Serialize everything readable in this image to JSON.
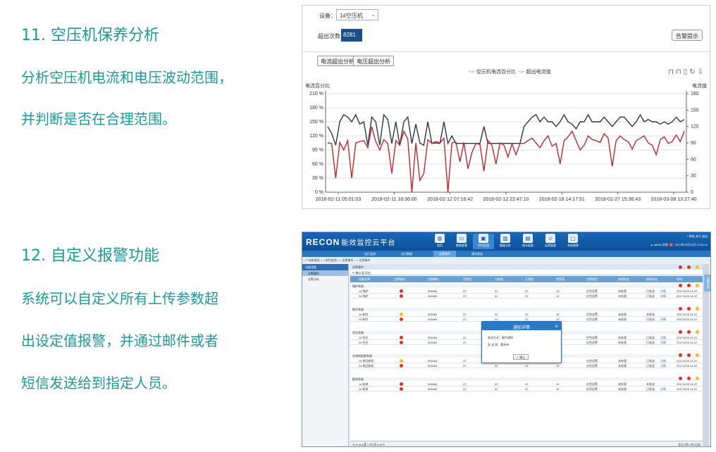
{
  "left_text": {
    "heading_11": "11. 空压机保养分析",
    "line_11_1": "分析空压机电流和电压波动范围，",
    "line_11_2": "并判断是否在合理范围。",
    "heading_12": "12. 自定义报警功能",
    "line_12_1": "系统可以自定义所有上传参数超",
    "line_12_2": "出设定值报警，并通过邮件或者",
    "line_12_3": "短信发送给到指定人员。"
  },
  "top_panel": {
    "device_label": "设备：",
    "device_value": "1#空压机",
    "exceed_label": "超出次数",
    "exceed_value": "8281",
    "alarm_button": "告警提示",
    "tab_current_exceed": "电流超出分析",
    "tab_voltage_exceed": "电压超出分析",
    "legend_percent": "空压机电流百分比",
    "legend_exceed": "超出电流值",
    "left_axis_label": "电流百分比",
    "right_axis_label": "电流值"
  },
  "chart_data": {
    "type": "line",
    "x_tick_labels": [
      "2018-02-11 05:01:03",
      "2018-02-11 18:36:00",
      "2018-02-12 07:16:42",
      "2018-02-12 22:47:10",
      "2018-02-18 14:17:51",
      "2018-02-27 15:36:43",
      "2018-03-08 13:27:40"
    ],
    "y_left_ticks": [
      "210 %",
      "180 %",
      "150 %",
      "120 %",
      "90 %",
      "60 %",
      "30 %",
      "0 %"
    ],
    "y_right_ticks": [
      "180",
      "150",
      "120",
      "90",
      "60",
      "30",
      "0"
    ],
    "ylim_left": [
      0,
      210
    ],
    "ylim_right": [
      0,
      180
    ],
    "grid": true,
    "legend": "top-center",
    "series": [
      {
        "name": "空压机电流百分比",
        "color": "#c0282e",
        "values": [
          105,
          104,
          30,
          106,
          90,
          110,
          30,
          105,
          108,
          110,
          95,
          140,
          108,
          90,
          112,
          104,
          40,
          110,
          100,
          130,
          113,
          0,
          105,
          25,
          40,
          112,
          104,
          108,
          105,
          115,
          0,
          105,
          107,
          65,
          106,
          50,
          85,
          104,
          102,
          45,
          110,
          100,
          60,
          105,
          100,
          75,
          103,
          80,
          104,
          104,
          110,
          115,
          105,
          95,
          110,
          120,
          98,
          104,
          60,
          110,
          118,
          130,
          110,
          90,
          100,
          120,
          112,
          110,
          106,
          125,
          115,
          55,
          110,
          120,
          112,
          108,
          92,
          110,
          115,
          120,
          105,
          100,
          80,
          112,
          118,
          104,
          108,
          122,
          108,
          130
        ]
      },
      {
        "name": "超出电流值",
        "color": "#2a3a4a",
        "values": [
          140,
          125,
          100,
          150,
          165,
          160,
          150,
          165,
          145,
          150,
          100,
          160,
          150,
          100,
          165,
          155,
          104,
          150,
          100,
          150,
          160,
          104,
          145,
          105,
          100,
          150,
          104,
          105,
          104,
          150,
          104,
          120,
          104,
          104,
          104,
          104,
          104,
          104,
          104,
          140,
          104,
          104,
          104,
          104,
          104,
          104,
          104,
          104,
          104,
          140,
          150,
          160,
          165,
          150,
          160,
          150,
          150,
          140,
          150,
          165,
          150,
          145,
          135,
          150,
          150,
          165,
          150,
          150,
          150,
          160,
          150,
          140,
          150,
          160,
          160,
          150,
          140,
          150,
          165,
          150,
          155,
          150,
          150,
          145,
          150,
          145,
          150,
          160,
          150,
          155
        ]
      }
    ]
  },
  "app": {
    "logo": "RECON",
    "logo_sub": "能效监控云平台",
    "nav": [
      {
        "label": "首页",
        "icon": "globe-icon"
      },
      {
        "label": "数据查看",
        "icon": "monitor-icon"
      },
      {
        "label": "实时监测",
        "icon": "screen-icon"
      },
      {
        "label": "数据分析",
        "icon": "bar-chart-icon"
      },
      {
        "label": "统计报表",
        "icon": "report-icon"
      },
      {
        "label": "运营管理",
        "icon": "person-icon"
      },
      {
        "label": "系统管理",
        "icon": "display-icon"
      }
    ],
    "top_links": "? 帮助   关于   退出",
    "user": "▲ admin  消息",
    "user_badge": "5",
    "datetime": "2017年05月02日 12:00:41",
    "subnav": [
      "运行监测",
      "运行数据",
      "告警事件",
      "通讯状态"
    ],
    "breadcrumb": "› 广州新塑园 > > 实时监测 > > 告警事件 > > 告警事件",
    "sidebar": {
      "title": "功能导航",
      "items": [
        "告警事件",
        "告警分析"
      ]
    },
    "main_title": "告警事件",
    "toolbar": "✎ 确认   ⎙ 导出",
    "columns": [
      "设备名称",
      "告警级别",
      "告警编号",
      "告警值",
      "当前值",
      "正常值",
      "报警值",
      "告警类型",
      "处理状态",
      "通知状态",
      "时间"
    ],
    "groups": [
      {
        "name": "锅炉系统",
        "rows": [
          {
            "device": "1# 锅炉",
            "level": "red",
            "code": "555484",
            "a": "22",
            "b": "32",
            "c": "22",
            "d": "10",
            "type": "红色告警",
            "state": "未处理",
            "notify": "已发送",
            "detail": "详情",
            "time": "2017/4/28 14:22"
          },
          {
            "device": "2# 锅炉",
            "level": "red",
            "code": "555484",
            "a": "22",
            "b": "32",
            "c": "22",
            "d": "10",
            "type": "红色告警",
            "state": "未处理",
            "notify": "已发送",
            "detail": "详情",
            "time": "2017/4/28 14:22"
          }
        ]
      },
      {
        "name": "制冷系统",
        "rows": [
          {
            "device": "1# 制冷",
            "level": "yellow",
            "code": "555484",
            "a": "22",
            "b": "32",
            "c": "22",
            "d": "10",
            "type": "红色告警",
            "state": "未处理",
            "notify": "未发送",
            "detail": "",
            "time": "2017/4/28 14:22"
          },
          {
            "device": "2# 制冷",
            "level": "red",
            "code": "555484",
            "a": "22",
            "b": "32",
            "c": "22",
            "d": "10",
            "type": "红色告警",
            "state": "未处理",
            "notify": "已发送",
            "detail": "详情",
            "time": "2017/4/28 14:22"
          }
        ]
      },
      {
        "name": "空压系统",
        "rows": [
          {
            "device": "1# 空压",
            "level": "red",
            "code": "555484",
            "a": "22",
            "b": "32",
            "c": "22",
            "d": "10",
            "type": "红色告警",
            "state": "未处理",
            "notify": "已发送",
            "detail": "详情",
            "time": "2017/4/28 14:22"
          },
          {
            "device": "2# 空压",
            "level": "red",
            "code": "555484",
            "a": "22",
            "b": "32",
            "c": "22",
            "d": "10",
            "type": "红色告警",
            "state": "未处理",
            "notify": "已发送",
            "detail": "详情",
            "time": "2017/4/28 14:22"
          }
        ]
      },
      {
        "name": "空调热回收系统",
        "rows": [
          {
            "device": "1# 热回收机",
            "level": "yellow",
            "code": "555484",
            "a": "22",
            "b": "32",
            "c": "22",
            "d": "10",
            "type": "红色告警",
            "state": "未处理",
            "notify": "已发送",
            "detail": "详情",
            "time": "2017/4/28 14:22"
          },
          {
            "device": "2# 热回收机",
            "level": "red",
            "code": "555484",
            "a": "22",
            "b": "32",
            "c": "22",
            "d": "10",
            "type": "红色告警",
            "state": "未处理",
            "notify": "已发送",
            "detail": "详情",
            "time": "2017/4/28 14:22"
          }
        ]
      },
      {
        "name": "配电系统",
        "rows": [
          {
            "device": "1# 配电",
            "level": "red",
            "code": "555484",
            "a": "22",
            "b": "33",
            "c": "22",
            "d": "10",
            "type": "红色告警",
            "state": "未处理",
            "notify": "未发送",
            "detail": "",
            "time": "2017/4/28 14:22"
          },
          {
            "device": "2# 配电",
            "level": "red",
            "code": "555484",
            "a": "22",
            "b": "32",
            "c": "22",
            "d": "10",
            "type": "红色告警",
            "state": "未处理",
            "notify": "已发送",
            "detail": "详情",
            "time": "2017/4/28 14:22"
          }
        ]
      }
    ],
    "modal": {
      "title": "通知详情",
      "line1": "发送方式：邮件通知",
      "line2": "发 送 到：董伟伟",
      "ok": "确认"
    },
    "pager_left": "10 ▾   |◂  ◂   第 1  共1页   ▸  ▸|   ↻",
    "pager_right": "显示1到1,共1记录",
    "side_tab": "告警分析"
  }
}
